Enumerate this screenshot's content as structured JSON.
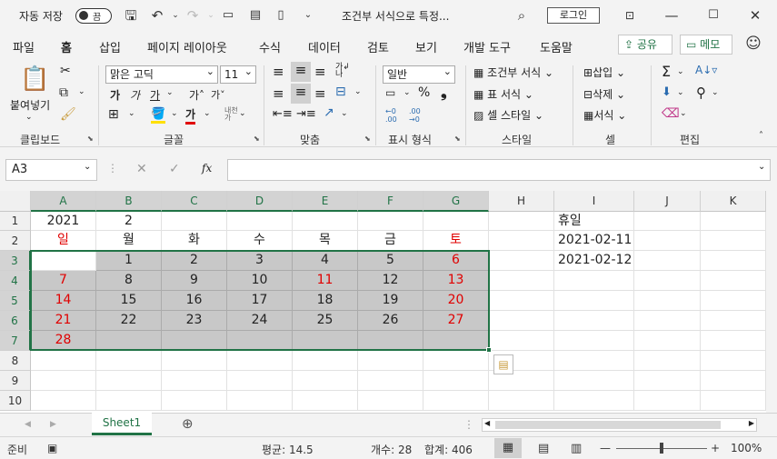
{
  "titlebar": {
    "autosave_label": "자동 저장",
    "autosave_toggle": "끔",
    "doc_title": "조건부 서식으로 특정...",
    "login_label": "로그인"
  },
  "tabs": [
    "파일",
    "홈",
    "삽입",
    "페이지 레이아웃",
    "수식",
    "데이터",
    "검토",
    "보기",
    "개발 도구",
    "도움말"
  ],
  "share_label": "공유",
  "memo_label": "메모",
  "ribbon": {
    "paste_label": "붙여넣기",
    "font_name": "맑은 고딕",
    "font_size": "11",
    "number_format": "일반",
    "conditional_format": "조건부 서식",
    "table_format": "표 서식",
    "cell_style": "셀 스타일",
    "insert": "삽입",
    "delete": "삭제",
    "format": "서식",
    "groups": [
      "클립보드",
      "글꼴",
      "맞춤",
      "표시 형식",
      "스타일",
      "셀",
      "편집"
    ]
  },
  "namebox": "A3",
  "columns": [
    "A",
    "B",
    "C",
    "D",
    "E",
    "F",
    "G",
    "H",
    "I",
    "J",
    "K"
  ],
  "rows": [
    "1",
    "2",
    "3",
    "4",
    "5",
    "6",
    "7",
    "8",
    "9",
    "10"
  ],
  "cells": {
    "r1": [
      "2021",
      "2",
      "",
      "",
      "",
      "",
      "",
      "",
      "휴일",
      "",
      ""
    ],
    "r2": [
      "일",
      "월",
      "화",
      "수",
      "목",
      "금",
      "토",
      "",
      "2021-02-11",
      "",
      ""
    ],
    "r3": [
      "",
      "1",
      "2",
      "3",
      "4",
      "5",
      "6",
      "",
      "2021-02-12",
      "",
      ""
    ],
    "r4": [
      "7",
      "8",
      "9",
      "10",
      "11",
      "12",
      "13",
      "",
      "",
      "",
      ""
    ],
    "r5": [
      "14",
      "15",
      "16",
      "17",
      "18",
      "19",
      "20",
      "",
      "",
      "",
      ""
    ],
    "r6": [
      "21",
      "22",
      "23",
      "24",
      "25",
      "26",
      "27",
      "",
      "",
      "",
      ""
    ],
    "r7": [
      "28",
      "",
      "",
      "",
      "",
      "",
      "",
      "",
      "",
      "",
      ""
    ],
    "r8": [
      "",
      "",
      "",
      "",
      "",
      "",
      "",
      "",
      "",
      "",
      ""
    ],
    "r9": [
      "",
      "",
      "",
      "",
      "",
      "",
      "",
      "",
      "",
      "",
      ""
    ],
    "r10": [
      "",
      "",
      "",
      "",
      "",
      "",
      "",
      "",
      "",
      "",
      ""
    ]
  },
  "sheet_tab": "Sheet1",
  "status": {
    "ready": "준비",
    "average": "평균: 14.5",
    "count": "개수: 28",
    "sum": "합계: 406",
    "zoom": "100%"
  },
  "colors": {
    "accent": "#217346",
    "holiday_red": "#e00000",
    "selection_fill": "#c8c8c8"
  }
}
